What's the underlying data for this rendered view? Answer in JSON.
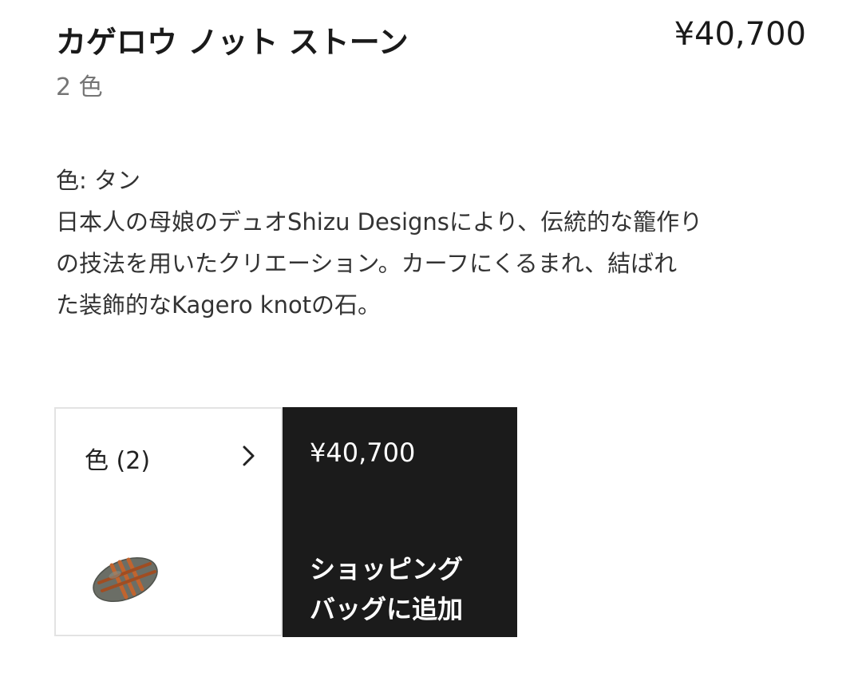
{
  "product": {
    "title": "カゲロウ ノット ストーン",
    "price": "¥40,700",
    "color_count": "2 色"
  },
  "description": {
    "selected_color": "色: タン",
    "lines": [
      "日本人の母娘のデュオShizu Designsにより、伝統的な籠作り",
      "の技法を用いたクリエーション。カーフにくるまれ、結ばれ",
      "た装飾的なKagero knotの石。"
    ]
  },
  "color_selector": {
    "label": "色 (2)",
    "chevron_icon": "chevron-right-icon",
    "swatch": "stone-product-thumbnail"
  },
  "add_to_bag": {
    "price": "¥40,700",
    "label_lines": [
      "ショッピング",
      "バッグに追加"
    ],
    "background": "#1b1b1b",
    "text_color": "#ffffff"
  }
}
